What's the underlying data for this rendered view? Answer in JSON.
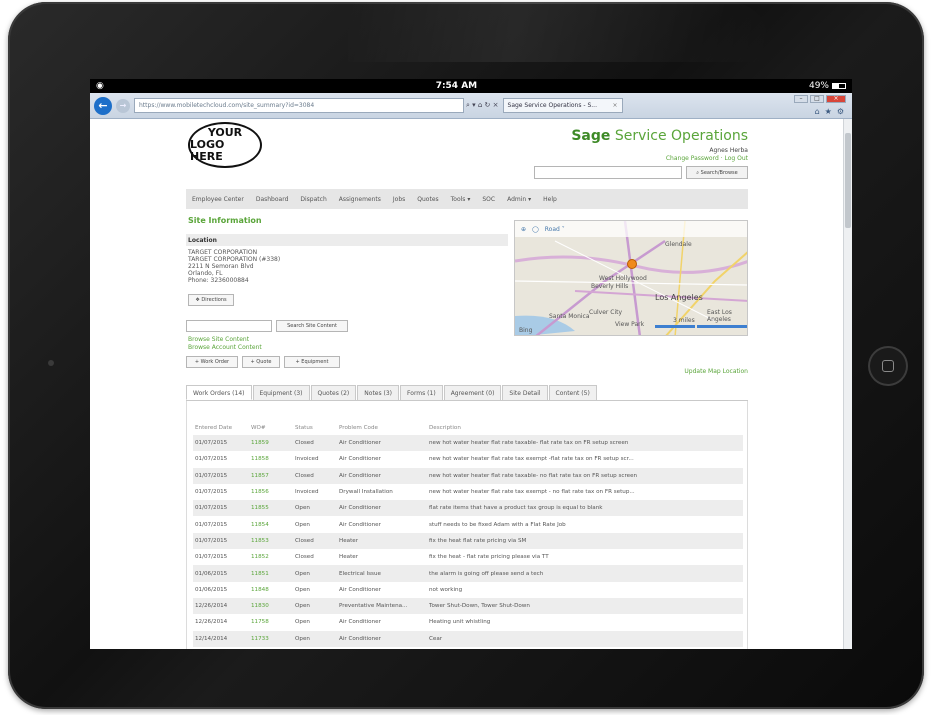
{
  "status_bar": {
    "time": "7:54 AM",
    "battery": "49%"
  },
  "browser": {
    "url": "https://www.mobiletechcloud.com/site_summary?id=3084",
    "tab_title": "Sage Service Operations - S...",
    "address_tools": "⌕ ▾ ⌂ ↻ ×"
  },
  "header": {
    "logo_line1": "YOUR",
    "logo_line2": "LOGO HERE",
    "brand_strong": "Sage",
    "brand_rest": " Service Operations",
    "user_name": "Agnes Herba",
    "user_links": "Change Password · Log Out",
    "search_button": "⌕ Search/Browse"
  },
  "nav": {
    "items": [
      "Employee Center",
      "Dashboard",
      "Dispatch",
      "Assignements",
      "Jobs",
      "Quotes",
      "Tools ▾",
      "SOC",
      "Admin ▾",
      "Help"
    ]
  },
  "site": {
    "section_title": "Site Information",
    "location_header": "Location",
    "location_lines": [
      "TARGET CORPORATION",
      "TARGET CORPORATION (#338)",
      "2211 N Semoran Blvd",
      "Orlando, FL",
      "Phone: 3236000884"
    ],
    "directions_button": "❖ Directions",
    "search_content_button": "Search Site Content",
    "browse_site": "Browse Site Content",
    "browse_account": "Browse Account Content",
    "add_work_order": "+ Work Order",
    "add_quote": "+ Quote",
    "add_equipment": "+ Equipment",
    "update_map": "Update Map Location"
  },
  "map": {
    "toolbar": "Road ˅",
    "labels": {
      "glendale": "Glendale",
      "hollywood": "West Hollywood",
      "beverly": "Beverly Hills",
      "la": "Los Angeles",
      "santa_monica": "Santa Monica",
      "culver": "Culver City",
      "east_la": "East Los Angeles",
      "view_park": "View Park",
      "bing": "Bing",
      "scale": "3 miles"
    }
  },
  "tabs": [
    "Work Orders (14)",
    "Equipment (3)",
    "Quotes (2)",
    "Notes (3)",
    "Forms (1)",
    "Agreement (0)",
    "Site Detail",
    "Content (5)"
  ],
  "work_orders": {
    "columns": [
      "Entered Date",
      "WO#",
      "Status",
      "Problem Code",
      "Description"
    ],
    "rows": [
      [
        "01/07/2015",
        "11859",
        "Closed",
        "Air Conditioner",
        "new hot water heater flat rate taxable- flat rate tax on FR setup screen"
      ],
      [
        "01/07/2015",
        "11858",
        "Invoiced",
        "Air Conditioner",
        "new hot water heater flat rate tax exempt -flat rate tax on FR setup scr..."
      ],
      [
        "01/07/2015",
        "11857",
        "Closed",
        "Air Conditioner",
        "new hot water heater flat rate taxable- no flat rate tax on FR setup screen"
      ],
      [
        "01/07/2015",
        "11856",
        "Invoiced",
        "Drywall Installation",
        "new hot water heater flat rate tax exempt - no flat rate tax on FR setup..."
      ],
      [
        "01/07/2015",
        "11855",
        "Open",
        "Air Conditioner",
        "flat rate items that have a product tax group is equal to blank"
      ],
      [
        "01/07/2015",
        "11854",
        "Open",
        "Air Conditioner",
        "stuff needs to be fixed Adam with a Flat Rate Job"
      ],
      [
        "01/07/2015",
        "11853",
        "Closed",
        "Heater",
        "fix the heat flat rate pricing via SM"
      ],
      [
        "01/07/2015",
        "11852",
        "Closed",
        "Heater",
        "fix the heat - flat rate pricing please via TT"
      ],
      [
        "01/06/2015",
        "11851",
        "Open",
        "Electrical Issue",
        "the alarm is going off please send a tech"
      ],
      [
        "01/06/2015",
        "11848",
        "Open",
        "Air Conditioner",
        "not working"
      ],
      [
        "12/26/2014",
        "11830",
        "Open",
        "Preventative Maintena...",
        "Tower Shut-Down, Tower Shut-Down"
      ],
      [
        "12/26/2014",
        "11758",
        "Open",
        "Air Conditioner",
        "Heating unit whistling"
      ],
      [
        "12/14/2014",
        "11733",
        "Open",
        "Air Conditioner",
        "Cear"
      ]
    ]
  },
  "colors": {
    "brand_green": "#5aa53a",
    "link_green": "#5aa53a",
    "browser_blue": "#1d6fc9"
  }
}
